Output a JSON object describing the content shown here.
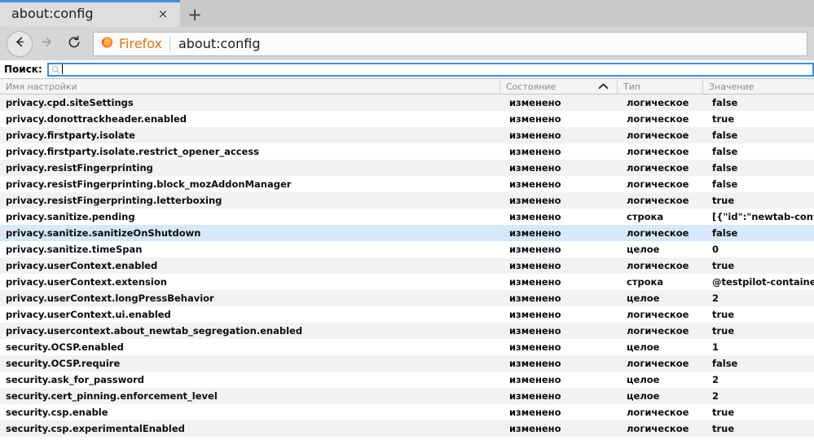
{
  "window": {
    "tab": {
      "title": "about:config",
      "close_label": "×"
    },
    "newtab_label": "+",
    "toolbar": {
      "back_icon": "back-arrow-icon",
      "forward_icon": "forward-arrow-icon",
      "reload_icon": "reload-icon",
      "brand_label": "Firefox",
      "url": "about:config"
    }
  },
  "page": {
    "search": {
      "label": "Поиск:",
      "value": "",
      "placeholder": ""
    },
    "table": {
      "headers": [
        "Имя настройки",
        "Состояние",
        "Тип",
        "Значение"
      ],
      "sorted_column": "Состояние",
      "sort_direction": "asc",
      "selected_row_index": 8,
      "rows": [
        {
          "name": "privacy.cpd.siteSettings",
          "status": "изменено",
          "type": "логическое",
          "value": "false"
        },
        {
          "name": "privacy.donottrackheader.enabled",
          "status": "изменено",
          "type": "логическое",
          "value": "true"
        },
        {
          "name": "privacy.firstparty.isolate",
          "status": "изменено",
          "type": "логическое",
          "value": "false"
        },
        {
          "name": "privacy.firstparty.isolate.restrict_opener_access",
          "status": "изменено",
          "type": "логическое",
          "value": "false"
        },
        {
          "name": "privacy.resistFingerprinting",
          "status": "изменено",
          "type": "логическое",
          "value": "false"
        },
        {
          "name": "privacy.resistFingerprinting.block_mozAddonManager",
          "status": "изменено",
          "type": "логическое",
          "value": "false"
        },
        {
          "name": "privacy.resistFingerprinting.letterboxing",
          "status": "изменено",
          "type": "логическое",
          "value": "true"
        },
        {
          "name": "privacy.sanitize.pending",
          "status": "изменено",
          "type": "строка",
          "value": "[{\"id\":\"newtab-contain"
        },
        {
          "name": "privacy.sanitize.sanitizeOnShutdown",
          "status": "изменено",
          "type": "логическое",
          "value": "false"
        },
        {
          "name": "privacy.sanitize.timeSpan",
          "status": "изменено",
          "type": "целое",
          "value": "0"
        },
        {
          "name": "privacy.userContext.enabled",
          "status": "изменено",
          "type": "логическое",
          "value": "true"
        },
        {
          "name": "privacy.userContext.extension",
          "status": "изменено",
          "type": "строка",
          "value": "@testpilot-containers"
        },
        {
          "name": "privacy.userContext.longPressBehavior",
          "status": "изменено",
          "type": "целое",
          "value": "2"
        },
        {
          "name": "privacy.userContext.ui.enabled",
          "status": "изменено",
          "type": "логическое",
          "value": "true"
        },
        {
          "name": "privacy.usercontext.about_newtab_segregation.enabled",
          "status": "изменено",
          "type": "логическое",
          "value": "true"
        },
        {
          "name": "security.OCSP.enabled",
          "status": "изменено",
          "type": "целое",
          "value": "1"
        },
        {
          "name": "security.OCSP.require",
          "status": "изменено",
          "type": "логическое",
          "value": "false"
        },
        {
          "name": "security.ask_for_password",
          "status": "изменено",
          "type": "целое",
          "value": "2"
        },
        {
          "name": "security.cert_pinning.enforcement_level",
          "status": "изменено",
          "type": "целое",
          "value": "2"
        },
        {
          "name": "security.csp.enable",
          "status": "изменено",
          "type": "логическое",
          "value": "true"
        },
        {
          "name": "security.csp.experimentalEnabled",
          "status": "изменено",
          "type": "логическое",
          "value": "true"
        }
      ]
    }
  },
  "colors": {
    "accent_blue": "#4a90d9",
    "brand_orange": "#e8740c",
    "selection_blue": "#d7e8fb",
    "row_alt": "#f2f2f2",
    "chrome_grey": "#d6d6d6"
  }
}
